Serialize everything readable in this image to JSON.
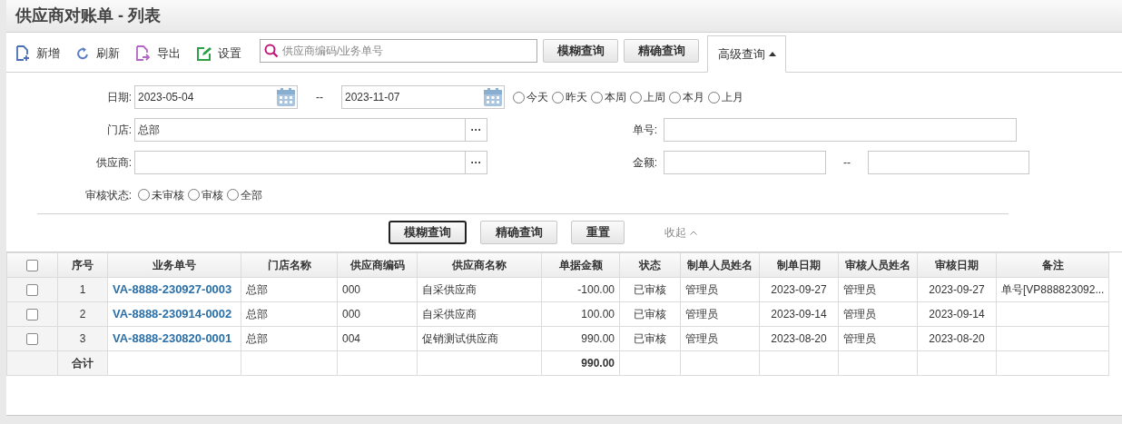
{
  "window": {
    "title": "供应商对账单 - 列表"
  },
  "toolbar": {
    "actions": [
      {
        "kind": "add",
        "label": "新增"
      },
      {
        "kind": "refresh",
        "label": "刷新"
      },
      {
        "kind": "export",
        "label": "导出"
      },
      {
        "kind": "settings",
        "label": "设置"
      }
    ],
    "search": {
      "placeholder": "供应商编码/业务单号"
    },
    "buttons": [
      "模糊查询",
      "精确查询"
    ],
    "advanced": {
      "label": "高级查询",
      "expanded": true
    }
  },
  "filters": {
    "date": {
      "label": "日期:",
      "from": "2023-05-04",
      "separator": "--",
      "to": "2023-11-07",
      "ranges": [
        {
          "label": "今天",
          "selected": false
        },
        {
          "label": "昨天",
          "selected": false
        },
        {
          "label": "本周",
          "selected": false
        },
        {
          "label": "上周",
          "selected": false
        },
        {
          "label": "本月",
          "selected": false
        },
        {
          "label": "上月",
          "selected": false
        }
      ]
    },
    "store": {
      "label": "门店:",
      "value": "总部",
      "picker": "···"
    },
    "number": {
      "label": "单号:"
    },
    "supplier": {
      "label": "供应商:",
      "picker": "···"
    },
    "amount": {
      "label": "金额:",
      "separator": "--"
    },
    "audit": {
      "label": "审核状态:",
      "options": [
        {
          "label": "未审核",
          "selected": false
        },
        {
          "label": "审核",
          "selected": false
        },
        {
          "label": "全部",
          "selected": false
        }
      ]
    },
    "buttons": [
      {
        "label": "模糊查询",
        "focused": true
      },
      {
        "label": "精确查询",
        "focused": false
      },
      {
        "label": "重置",
        "focused": false
      }
    ],
    "collapse": "收起"
  },
  "table": {
    "all_checked": false,
    "columns": [
      "序号",
      "业务单号",
      "门店名称",
      "供应商编码",
      "供应商名称",
      "单据金额",
      "状态",
      "制单人员姓名",
      "制单日期",
      "审核人员姓名",
      "审核日期",
      "备注"
    ],
    "rows": [
      {
        "checked": false,
        "cells": [
          "1",
          "VA-8888-230927-0003",
          "总部",
          "000",
          "自采供应商",
          "-100.00",
          "已审核",
          "管理员",
          "2023-09-27",
          "管理员",
          "2023-09-27",
          "单号[VP888823092..."
        ]
      },
      {
        "checked": false,
        "cells": [
          "2",
          "VA-8888-230914-0002",
          "总部",
          "000",
          "自采供应商",
          "100.00",
          "已审核",
          "管理员",
          "2023-09-14",
          "管理员",
          "2023-09-14",
          ""
        ]
      },
      {
        "checked": false,
        "cells": [
          "3",
          "VA-8888-230820-0001",
          "总部",
          "004",
          "促销测试供应商",
          "990.00",
          "已审核",
          "管理员",
          "2023-08-20",
          "管理员",
          "2023-08-20",
          ""
        ]
      }
    ],
    "total": {
      "label": "合计",
      "amount": "990.00"
    }
  }
}
